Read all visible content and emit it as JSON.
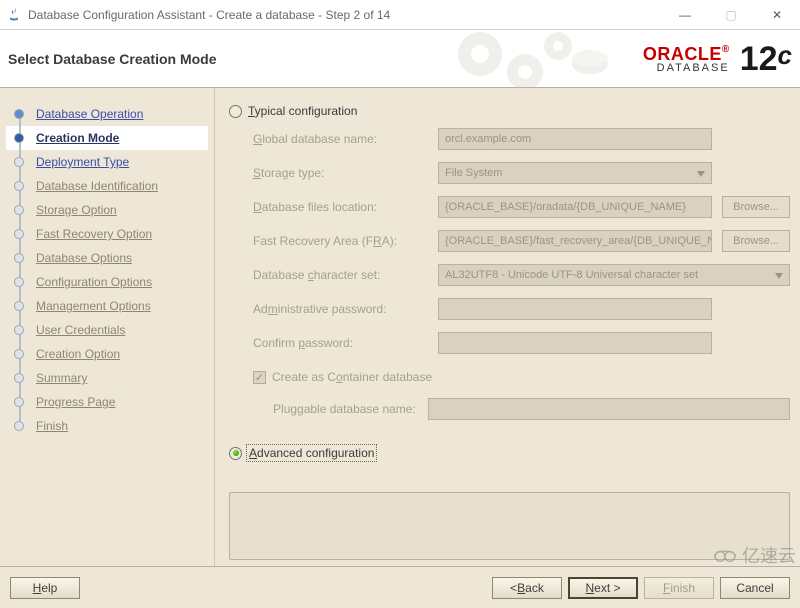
{
  "window": {
    "title": "Database Configuration Assistant - Create a database - Step 2 of 14"
  },
  "banner": {
    "subtitle": "Select Database Creation Mode",
    "brand_word": "ORACLE",
    "brand_sub": "DATABASE",
    "brand_ver_num": "12",
    "brand_ver_c": "c"
  },
  "sidebar": {
    "steps": [
      {
        "label": "Database Operation",
        "link": true,
        "state": "done"
      },
      {
        "label": "Creation Mode",
        "link": true,
        "state": "active"
      },
      {
        "label": "Deployment Type",
        "link": true,
        "state": "next"
      },
      {
        "label": "Database Identification",
        "link": false,
        "state": "future"
      },
      {
        "label": "Storage Option",
        "link": false,
        "state": "future"
      },
      {
        "label": "Fast Recovery Option",
        "link": false,
        "state": "future"
      },
      {
        "label": "Database Options",
        "link": false,
        "state": "future"
      },
      {
        "label": "Configuration Options",
        "link": false,
        "state": "future"
      },
      {
        "label": "Management Options",
        "link": false,
        "state": "future"
      },
      {
        "label": "User Credentials",
        "link": false,
        "state": "future"
      },
      {
        "label": "Creation Option",
        "link": false,
        "state": "future"
      },
      {
        "label": "Summary",
        "link": false,
        "state": "future"
      },
      {
        "label": "Progress Page",
        "link": false,
        "state": "future"
      },
      {
        "label": "Finish",
        "link": false,
        "state": "future"
      }
    ]
  },
  "panel": {
    "radio_typical_label": "Typical configuration",
    "radio_typical_ul": "T",
    "radio_advanced_label": "Advanced configuration",
    "radio_advanced_ul": "A",
    "selected_radio": "advanced",
    "fields": {
      "global_db": {
        "label_pre": "",
        "ul": "G",
        "label_post": "lobal database name:",
        "value": "orcl.example.com"
      },
      "storage": {
        "label_pre": "",
        "ul": "S",
        "label_post": "torage type:",
        "value": "File System"
      },
      "files_loc": {
        "label_pre": "",
        "ul": "D",
        "label_post": "atabase files location:",
        "value": "{ORACLE_BASE}/oradata/{DB_UNIQUE_NAME}",
        "browse": "Browse..."
      },
      "fra": {
        "label_pre": "Fast Recovery Area (F",
        "ul": "R",
        "label_post": "A):",
        "value": "{ORACLE_BASE}/fast_recovery_area/{DB_UNIQUE_NAME}",
        "browse": "Browse..."
      },
      "charset": {
        "label_pre": "Database ",
        "ul": "c",
        "label_post": "haracter set:",
        "value": "AL32UTF8 - Unicode UTF-8 Universal character set"
      },
      "admin_pw": {
        "label_pre": "Ad",
        "ul": "m",
        "label_post": "inistrative password:",
        "value": ""
      },
      "confirm_pw": {
        "label_pre": "Confirm ",
        "ul": "p",
        "label_post": "assword:",
        "value": ""
      },
      "container_chk": {
        "checked": true,
        "label_pre": "Create as C",
        "ul": "o",
        "label_post": "ntainer database"
      },
      "pdb": {
        "label_pre": "P",
        "ul": "l",
        "label_post": "uggable database name:",
        "value": ""
      }
    }
  },
  "footer": {
    "help": "Help",
    "back": "< Back",
    "next": "Next >",
    "finish": "Finish",
    "cancel": "Cancel",
    "help_ul": "H",
    "back_ul": "B",
    "next_ul": "N",
    "finish_ul": "F"
  },
  "watermark": "亿速云"
}
